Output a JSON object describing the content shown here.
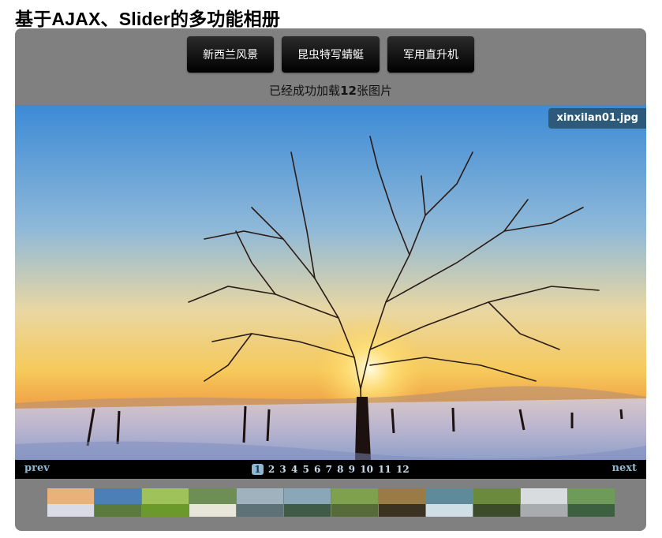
{
  "page": {
    "title": "基于AJAX、Slider的多功能相册"
  },
  "albums": [
    {
      "label": "新西兰风景"
    },
    {
      "label": "昆虫特写蜻蜓"
    },
    {
      "label": "军用直升机"
    }
  ],
  "status": {
    "prefix": "已经成功加载",
    "count": "12",
    "suffix": "张图片"
  },
  "viewer": {
    "filename": "xinxilan01.jpg",
    "image": "winter sunset tree photo"
  },
  "nav": {
    "prev": "prev",
    "next": "next",
    "pages": [
      "1",
      "2",
      "3",
      "4",
      "5",
      "6",
      "7",
      "8",
      "9",
      "10",
      "11",
      "12"
    ],
    "current_page": 1
  },
  "thumbnails": [
    {
      "subject": "winter tree at sunset",
      "sky": "#e9b27a",
      "ground": "#d9dbe6"
    },
    {
      "subject": "blue sky over green hills",
      "sky": "#4a7fb8",
      "ground": "#5b7a3e"
    },
    {
      "subject": "green grass blades",
      "sky": "#9fc25a",
      "ground": "#6c9a2a"
    },
    {
      "subject": "white daisies",
      "sky": "#6f8e55",
      "ground": "#e8e6d8"
    },
    {
      "subject": "lake reflection",
      "sky": "#9fb2bd",
      "ground": "#5d7276"
    },
    {
      "subject": "mountain lake",
      "sky": "#8aa7b8",
      "ground": "#3f5a47"
    },
    {
      "subject": "green forest path",
      "sky": "#7fa04f",
      "ground": "#566b37"
    },
    {
      "subject": "autumn sunlight forest",
      "sky": "#9a7a45",
      "ground": "#3b3222"
    },
    {
      "subject": "waterfall",
      "sky": "#5f8a9a",
      "ground": "#cfdfe5"
    },
    {
      "subject": "forest trees",
      "sky": "#6b8a3c",
      "ground": "#3c4b2a"
    },
    {
      "subject": "snowy forest",
      "sky": "#d9dcdf",
      "ground": "#a8acae"
    },
    {
      "subject": "green bushes",
      "sky": "#6e9a5a",
      "ground": "#3d6140"
    }
  ],
  "colors": {
    "panel": "#808080",
    "accent": "#8fb7cf",
    "filename_bg": "#2d5a78"
  }
}
